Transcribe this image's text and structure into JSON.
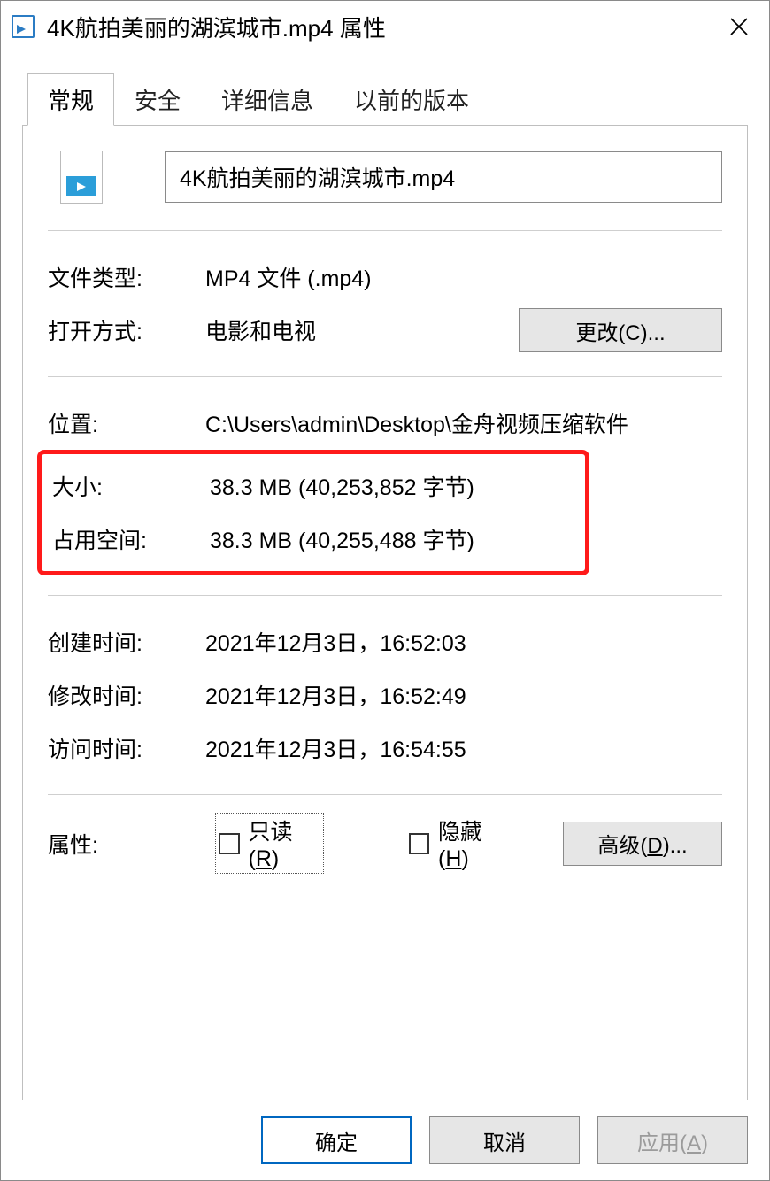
{
  "titlebar": {
    "title": "4K航拍美丽的湖滨城市.mp4 属性"
  },
  "tabs": {
    "general": "常规",
    "security": "安全",
    "details": "详细信息",
    "previous": "以前的版本"
  },
  "general": {
    "filename": "4K航拍美丽的湖滨城市.mp4",
    "filetype_label": "文件类型:",
    "filetype_value": "MP4 文件 (.mp4)",
    "openwith_label": "打开方式:",
    "openwith_value": "电影和电视",
    "change_btn": "更改(C)...",
    "location_label": "位置:",
    "location_value": "C:\\Users\\admin\\Desktop\\金舟视频压缩软件",
    "size_label": "大小:",
    "size_value": "38.3 MB (40,253,852 字节)",
    "sizeondisk_label": "占用空间:",
    "sizeondisk_value": "38.3 MB (40,255,488 字节)",
    "created_label": "创建时间:",
    "created_value": "2021年12月3日，16:52:03",
    "modified_label": "修改时间:",
    "modified_value": "2021年12月3日，16:52:49",
    "accessed_label": "访问时间:",
    "accessed_value": "2021年12月3日，16:54:55",
    "attributes_label": "属性:",
    "readonly_label_pre": "只读(",
    "readonly_label_key": "R",
    "readonly_label_post": ")",
    "hidden_label_pre": "隐藏(",
    "hidden_label_key": "H",
    "hidden_label_post": ")",
    "advanced_btn_pre": "高级(",
    "advanced_btn_key": "D",
    "advanced_btn_post": ")..."
  },
  "footer": {
    "ok": "确定",
    "cancel": "取消",
    "apply_pre": "应用(",
    "apply_key": "A",
    "apply_post": ")"
  }
}
